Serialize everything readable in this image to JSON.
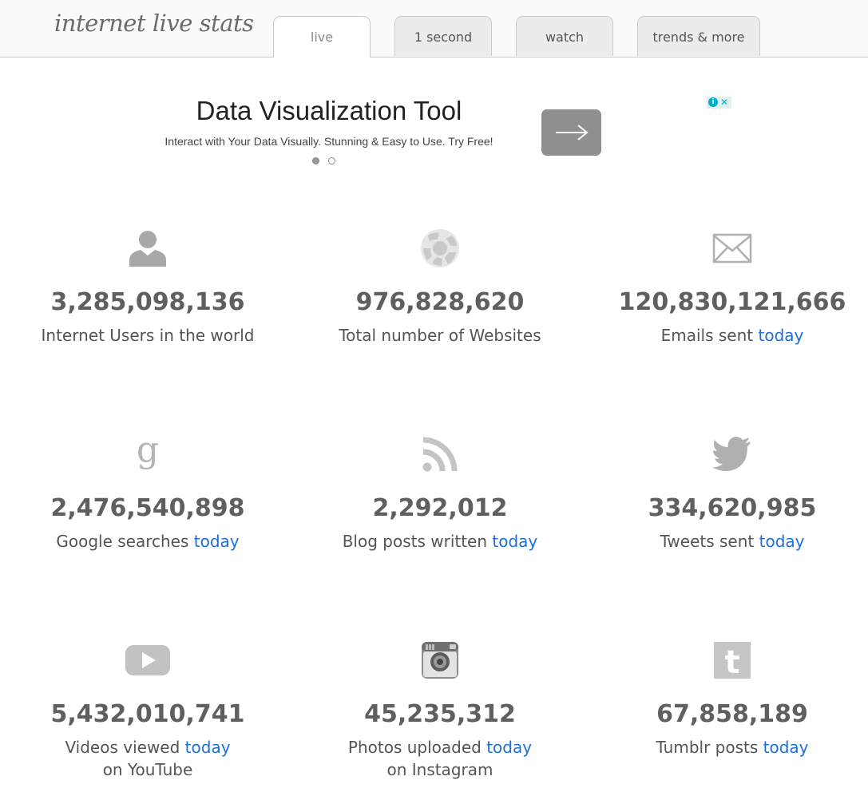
{
  "header": {
    "logo": "internet live stats",
    "tabs": [
      {
        "label": "live",
        "active": true
      },
      {
        "label": "1 second",
        "active": false
      },
      {
        "label": "watch",
        "active": false
      },
      {
        "label": "trends & more",
        "active": false
      }
    ]
  },
  "ad": {
    "title": "Data Visualization Tool",
    "subtitle": "Interact with Your Data Visually. Stunning & Easy to Use. Try Free!",
    "button_icon": "arrow-right-icon",
    "info_icon": "adchoices-info-icon",
    "close_glyph": "✕"
  },
  "stats": [
    {
      "icon": "user-icon",
      "value": "3,285,098,136",
      "label": "Internet Users in the world",
      "link": "",
      "line2": ""
    },
    {
      "icon": "globe-icon",
      "value": "976,828,620",
      "label": "Total number of Websites",
      "link": "",
      "line2": ""
    },
    {
      "icon": "envelope-icon",
      "value": "120,830,121,666",
      "label": "Emails sent",
      "link": "today",
      "line2": ""
    },
    {
      "icon": "google-icon",
      "value": "2,476,540,898",
      "label": "Google searches",
      "link": "today",
      "line2": ""
    },
    {
      "icon": "rss-icon",
      "value": "2,292,012",
      "label": "Blog posts written",
      "link": "today",
      "line2": ""
    },
    {
      "icon": "twitter-bird-icon",
      "value": "334,620,985",
      "label": "Tweets sent",
      "link": "today",
      "line2": ""
    },
    {
      "icon": "youtube-icon",
      "value": "5,432,010,741",
      "label": "Videos viewed",
      "link": "today",
      "line2": "on YouTube"
    },
    {
      "icon": "instagram-camera-icon",
      "value": "45,235,312",
      "label": "Photos uploaded",
      "link": "today",
      "line2": "on Instagram"
    },
    {
      "icon": "tumblr-icon",
      "value": "67,858,189",
      "label": "Tumblr posts",
      "link": "today",
      "line2": ""
    }
  ],
  "colors": {
    "accent_link": "#1f6fd6",
    "number_text": "#5f5f5f",
    "icon_gray": "#a8a8a8",
    "ad_button": "#8f8f8f",
    "ad_info": "#00aecd"
  }
}
